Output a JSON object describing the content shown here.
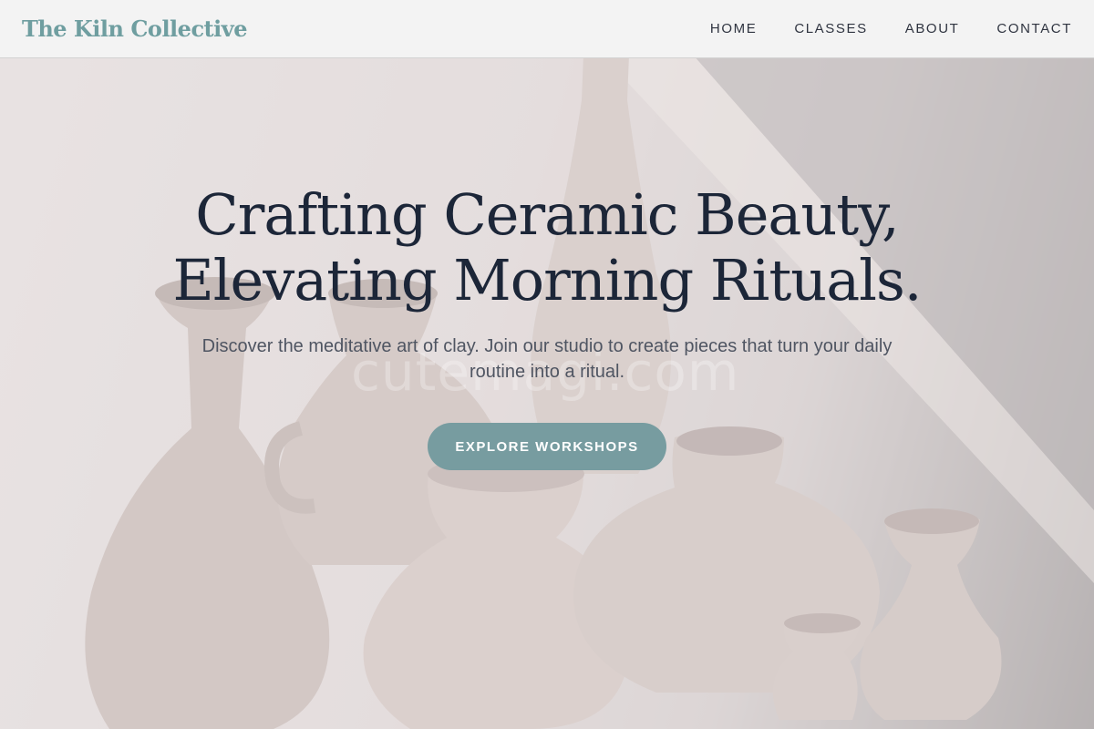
{
  "brand": {
    "name": "The Kiln Collective",
    "color": "#6f9ea0"
  },
  "nav": {
    "items": [
      {
        "label": "HOME"
      },
      {
        "label": "CLASSES"
      },
      {
        "label": "ABOUT"
      },
      {
        "label": "CONTACT"
      }
    ]
  },
  "hero": {
    "title": "Crafting Ceramic Beauty, Elevating Morning Rituals.",
    "subtitle": "Discover the meditative art of clay. Join our studio to create pieces that turn your daily routine into a ritual.",
    "cta_label": "EXPLORE WORKSHOPS",
    "cta_color": "#779ca0",
    "background_image": "ceramic-vases-photo",
    "watermark": "cutemagi.com"
  },
  "colors": {
    "title_text": "#1c2638",
    "subtitle_text": "#4f5562",
    "nav_text": "#2f3440"
  }
}
